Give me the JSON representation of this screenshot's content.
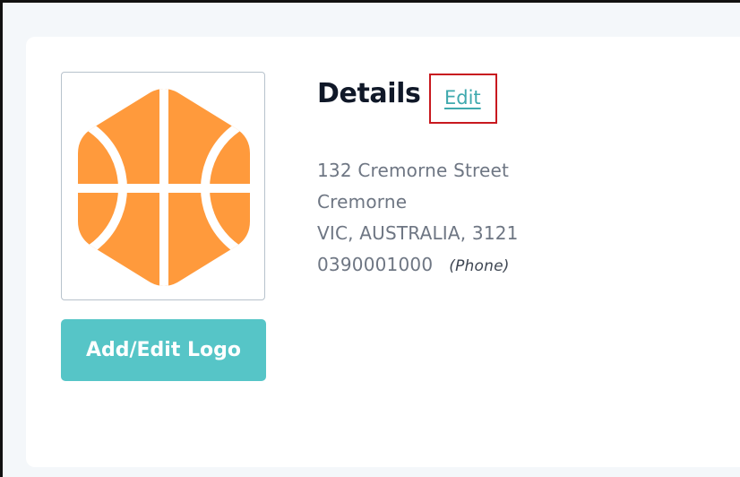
{
  "details": {
    "title": "Details",
    "edit_label": "Edit",
    "address_line_1": "132 Cremorne Street",
    "address_line_2": "Cremorne",
    "address_line_3": "VIC,  AUSTRALIA,  3121",
    "phone": "0390001000",
    "phone_type": "(Phone)"
  },
  "logo": {
    "icon": "basketball-hexagon-logo",
    "button_label": "Add/Edit Logo",
    "color": "#ff9a3c"
  },
  "colors": {
    "accent_teal": "#56c5c7",
    "highlight_red": "#c8191f",
    "card_background": "#ffffff",
    "page_background": "#f4f7fa"
  }
}
